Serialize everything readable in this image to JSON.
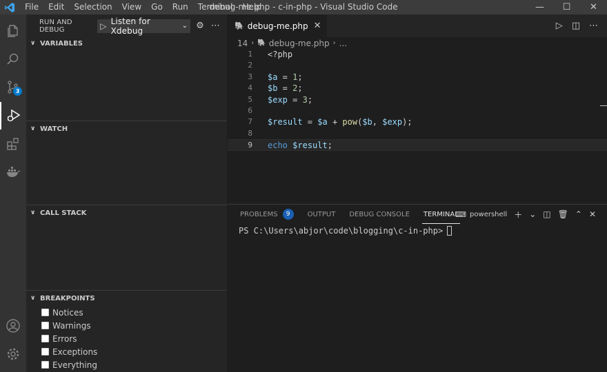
{
  "titlebar": {
    "menu": [
      "File",
      "Edit",
      "Selection",
      "View",
      "Go",
      "Run",
      "Terminal",
      "Help"
    ],
    "title": "debug-me.php - c-in-php - Visual Studio Code",
    "controls": {
      "minimize": "—",
      "maximize": "☐",
      "close": "✕"
    }
  },
  "activitybar": {
    "items": [
      {
        "icon": "files-icon"
      },
      {
        "icon": "search-icon"
      },
      {
        "icon": "source-control-icon",
        "badge": "3"
      },
      {
        "icon": "run-debug-icon",
        "active": true
      },
      {
        "icon": "extensions-icon"
      },
      {
        "icon": "docker-icon"
      }
    ],
    "bottom": [
      {
        "icon": "account-icon"
      },
      {
        "icon": "manage-gear-icon"
      }
    ]
  },
  "sidebar": {
    "header": "RUN AND DEBUG",
    "config": "Listen for Xdebug",
    "sections": {
      "variables": "VARIABLES",
      "watch": "WATCH",
      "callstack": "CALL STACK",
      "breakpoints": "BREAKPOINTS"
    },
    "breakpoints": [
      "Notices",
      "Warnings",
      "Errors",
      "Exceptions",
      "Everything"
    ]
  },
  "editor": {
    "tab": "debug-me.php",
    "breadcrumb": {
      "line": "14",
      "file": "debug-me.php",
      "more": "..."
    },
    "line_numbers": [
      "1",
      "2",
      "3",
      "4",
      "5",
      "6",
      "7",
      "8",
      "9"
    ],
    "active_line": "9"
  },
  "panel": {
    "tabs": {
      "problems": "PROBLEMS",
      "problems_count": "9",
      "output": "OUTPUT",
      "debug_console": "DEBUG CONSOLE",
      "terminal": "TERMINAL"
    },
    "shell": "powershell",
    "prompt": "PS C:\\Users\\abjor\\code\\blogging\\c-in-php>"
  }
}
